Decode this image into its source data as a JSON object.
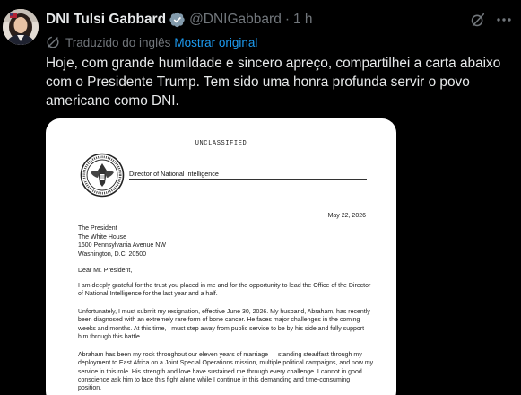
{
  "post": {
    "display_name": "DNI Tulsi Gabbard",
    "handle": "@DNIGabbard",
    "separator": "·",
    "time": "1 h",
    "translated_label": "Traduzido do inglês",
    "show_original_label": "Mostrar original",
    "text": "Hoje, com grande humildade e sincero apreço, compartilhei a carta abaixo com o Presidente Trump. Tem sido uma honra profunda servir o povo americano como DNI."
  },
  "letter": {
    "classification": "UNCLASSIFIED",
    "office": "Director of National Intelligence",
    "date": "May 22, 2026",
    "recipient": [
      "The President",
      "The White House",
      "1600 Pennsylvania Avenue NW",
      "Washington, D.C. 20500"
    ],
    "salutation": "Dear Mr. President,",
    "paragraphs": [
      "I am deeply grateful for the trust you placed in me and for the opportunity to lead the Office of the Director of National Intelligence for the last year and a half.",
      "Unfortunately, I must submit my resignation, effective June 30, 2026. My husband, Abraham, has recently been diagnosed with an extremely rare form of bone cancer. He faces major challenges in the coming weeks and months. At this time, I must step away from public service to be by his side and fully support him through this battle.",
      "Abraham has been my rock throughout our eleven years of marriage — standing steadfast through my deployment to East Africa on a Joint Special Operations mission, multiple political campaigns, and now my service in this role. His strength and love have sustained me through every challenge. I cannot in good conscience ask him to face this fight alone while I continue in this demanding and time-consuming position."
    ]
  },
  "icons": {
    "verified": "verified-badge-icon",
    "grok": "grok-icon",
    "more": "more-options-icon",
    "translate": "translate-icon"
  },
  "colors": {
    "background": "#000000",
    "text": "#e7e9ea",
    "muted": "#71767b",
    "link": "#1d9bf0",
    "badge": "#829aab"
  }
}
